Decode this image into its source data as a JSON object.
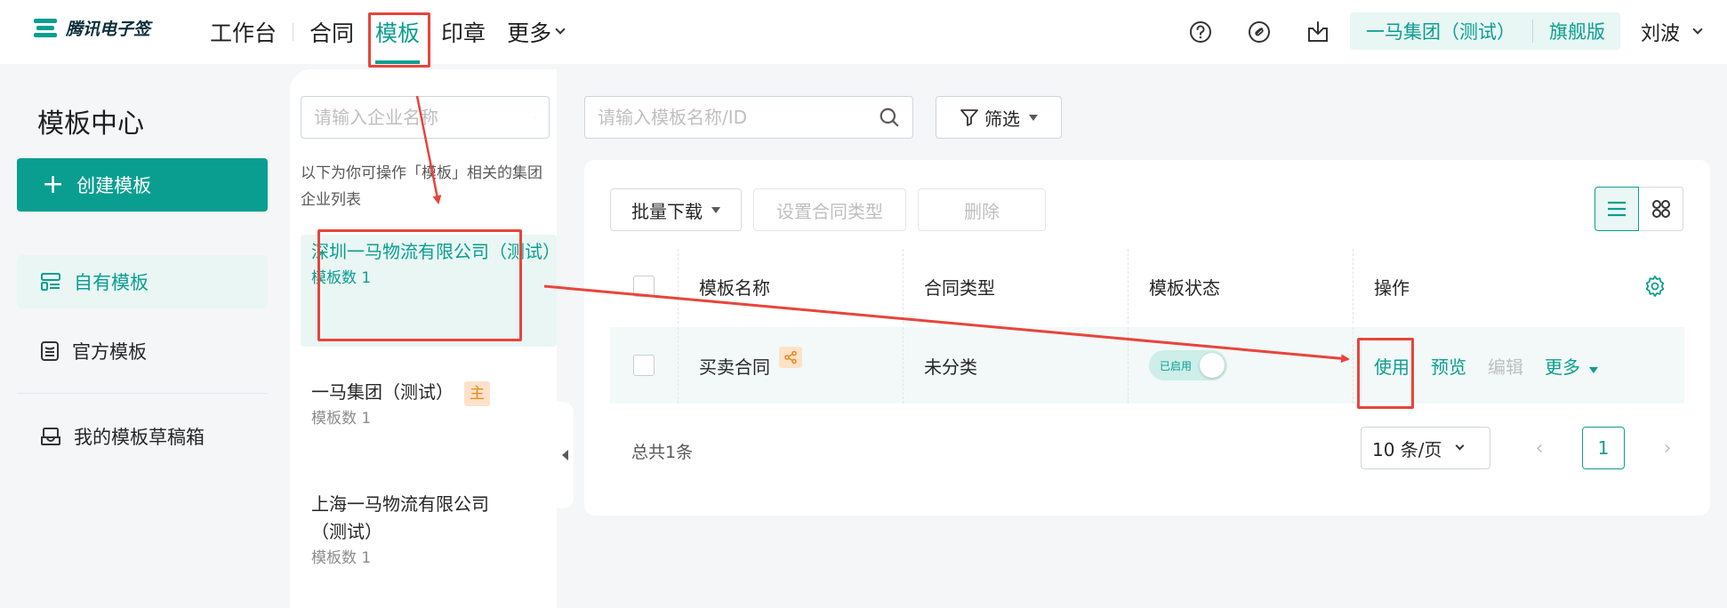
{
  "topbar": {
    "logo_text": "腾讯电子签",
    "nav": [
      {
        "label": "工作台"
      },
      {
        "label": "合同"
      },
      {
        "label": "模板"
      },
      {
        "label": "印章"
      },
      {
        "label": "更多"
      }
    ],
    "org_name": "一马集团（测试）",
    "edition": "旗舰版",
    "user_name": "刘波"
  },
  "sidebar": {
    "title": "模板中心",
    "create_button": "创建模板",
    "items": [
      {
        "label": "自有模板"
      },
      {
        "label": "官方模板"
      },
      {
        "label": "我的模板草稿箱"
      }
    ]
  },
  "company_panel": {
    "search_placeholder": "请输入企业名称",
    "hint": "以下为你可操作「模板」相关的集团企业列表",
    "companies": [
      {
        "name": "深圳一马物流有限公司（测试）",
        "count": "模板数 1"
      },
      {
        "name": "一马集团（测试）",
        "count": "模板数 1",
        "tag": "主"
      },
      {
        "name": "上海一马物流有限公司（测试）",
        "count": "模板数 1"
      }
    ]
  },
  "main": {
    "search_placeholder": "请输入模板名称/ID",
    "filter_label": "筛选",
    "toolbar": {
      "batch_download": "批量下载",
      "set_type": "设置合同类型",
      "delete": "删除"
    },
    "table": {
      "headers": [
        "模板名称",
        "合同类型",
        "模板状态",
        "操作"
      ],
      "rows": [
        {
          "name": "买卖合同",
          "type": "未分类",
          "status": "已启用",
          "actions": {
            "use": "使用",
            "preview": "预览",
            "edit": "编辑",
            "more": "更多"
          }
        }
      ]
    },
    "total": "总共1条",
    "page_size": "10 条/页",
    "current_page": "1"
  },
  "colors": {
    "accent": "#0a9e91",
    "annotation": "#e8443a"
  }
}
